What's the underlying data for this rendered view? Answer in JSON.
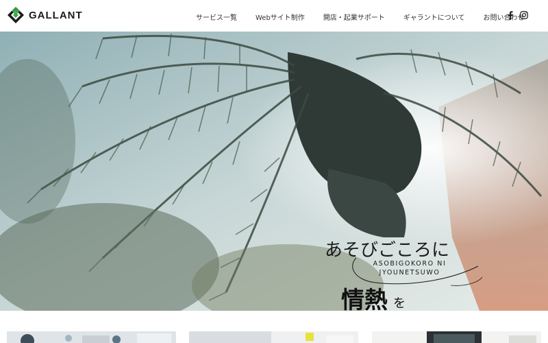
{
  "brand": {
    "name": "GALLANT"
  },
  "nav": {
    "items": [
      {
        "label": "サービス一覧"
      },
      {
        "label": "Webサイト制作"
      },
      {
        "label": "開店・起業サポート"
      },
      {
        "label": "ギャラントについて"
      },
      {
        "label": "お問い合わせ"
      }
    ]
  },
  "social": {
    "facebook_icon": "f",
    "instagram_icon": "instagram-icon"
  },
  "hero": {
    "catch_main": "あそびごころに",
    "catch_sub_line1": "ASOBIGOKORO NI",
    "catch_sub_line2": "JYOUNETSUWO",
    "catch_hot": "情熱",
    "catch_wo": "を"
  },
  "colors": {
    "brand_green": "#3aa84a",
    "brand_dark": "#1b1b1b"
  }
}
